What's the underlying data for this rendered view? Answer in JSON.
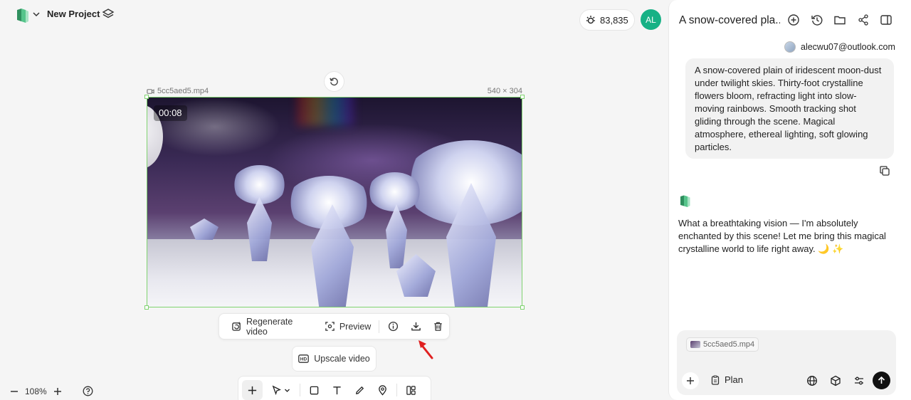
{
  "header": {
    "project_name": "New Project",
    "credits": "83,835",
    "user_initials": "AL",
    "accent_color": "#17b185"
  },
  "canvas": {
    "file_name": "5cc5aed5.mp4",
    "dimensions": "540 × 304",
    "timestamp": "00:08",
    "actions": {
      "regenerate": "Regenerate video",
      "preview": "Preview"
    },
    "upscale": "Upscale video",
    "zoom": "108%"
  },
  "chat": {
    "title": "A snow-covered pla...",
    "user_email": "alecwu07@outlook.com",
    "user_message": "A snow-covered plain of iridescent moon-dust under twilight skies. Thirty-foot crystalline flowers bloom, refracting light into slow-moving rainbows. Smooth tracking shot gliding through the scene. Magical atmosphere, ethereal lighting, soft glowing particles.",
    "assistant_message": "What a breathtaking vision — I'm absolutely enchanted by this scene! Let me bring this magical crystalline world to life right away. 🌙 ✨",
    "attachment": "5cc5aed5.mp4",
    "plan_label": "Plan"
  }
}
